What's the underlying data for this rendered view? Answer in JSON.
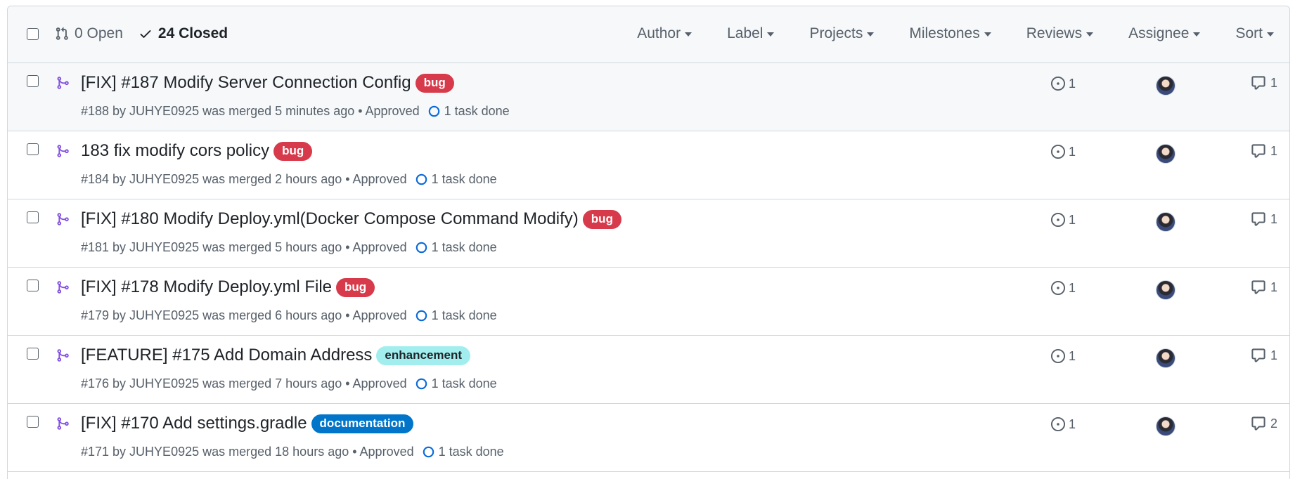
{
  "header": {
    "open_label": "0 Open",
    "closed_label": "24 Closed",
    "filters": [
      "Author",
      "Label",
      "Projects",
      "Milestones",
      "Reviews",
      "Assignee",
      "Sort"
    ]
  },
  "colors": {
    "bug": "#d73a4a",
    "enhancement": "#a2eeef",
    "documentation": "#0075ca",
    "merged": "#8250df",
    "task": "#0969da"
  },
  "rows": [
    {
      "title": "[FIX] #187 Modify Server Connection Config",
      "label": "bug",
      "meta": "#188 by JUHYE0925 was merged 5 minutes ago • Approved",
      "task": "1 task done",
      "links": "1",
      "comments": "1"
    },
    {
      "title": "183 fix modify cors policy",
      "label": "bug",
      "meta": "#184 by JUHYE0925 was merged 2 hours ago • Approved",
      "task": "1 task done",
      "links": "1",
      "comments": "1"
    },
    {
      "title": "[FIX] #180 Modify Deploy.yml(Docker Compose Command Modify)",
      "label": "bug",
      "meta": "#181 by JUHYE0925 was merged 5 hours ago • Approved",
      "task": "1 task done",
      "links": "1",
      "comments": "1"
    },
    {
      "title": "[FIX] #178 Modify Deploy.yml File",
      "label": "bug",
      "meta": "#179 by JUHYE0925 was merged 6 hours ago • Approved",
      "task": "1 task done",
      "links": "1",
      "comments": "1"
    },
    {
      "title": "[FEATURE] #175 Add Domain Address",
      "label": "enhancement",
      "meta": "#176 by JUHYE0925 was merged 7 hours ago • Approved",
      "task": "1 task done",
      "links": "1",
      "comments": "1"
    },
    {
      "title": "[FIX] #170 Add settings.gradle",
      "label": "documentation",
      "meta": "#171 by JUHYE0925 was merged 18 hours ago • Approved",
      "task": "1 task done",
      "links": "1",
      "comments": "2"
    }
  ]
}
